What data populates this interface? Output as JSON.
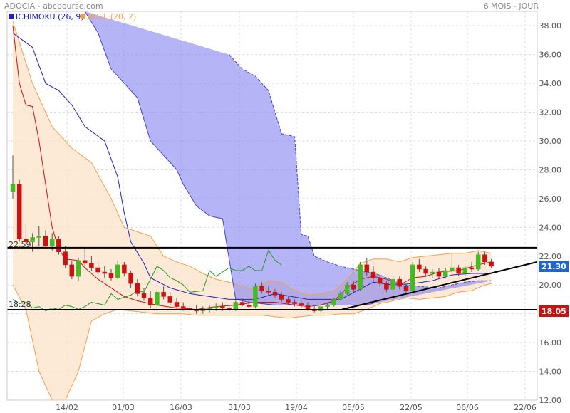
{
  "header": {
    "title": "ADOCIA - abcbourse.com",
    "period": "6 MOIS - JOUR"
  },
  "legend": {
    "ichimoku": "ICHIMOKU (26, 9)",
    "boll": "BOLL (20, 2)"
  },
  "colors": {
    "up": "#44bb22",
    "down": "#cc1111",
    "kijun": "#2222bb",
    "tenkan": "#cc1111",
    "chikou": "#229922",
    "cloud": "#7777ee",
    "boll": "#f3a04a",
    "bollFill": "#fbe3cc",
    "priceTag": "#2266cc",
    "supportTag": "#cc1111"
  },
  "chart_data": {
    "type": "candlestick",
    "ylim": [
      12,
      39
    ],
    "yticks": [
      "12.00",
      "14.00",
      "16.00",
      "18.00",
      "20.00",
      "22.00",
      "24.00",
      "26.00",
      "28.00",
      "30.00",
      "32.00",
      "34.00",
      "36.00",
      "38.00"
    ],
    "xticks": [
      "14/02",
      "01/03",
      "16/03",
      "31/03",
      "19/04",
      "05/05",
      "22/05",
      "06/06",
      "22/06"
    ],
    "levels": {
      "resistance": 22.59,
      "support": 18.28,
      "resistance_label": "22.59",
      "support_label": "18.28"
    },
    "last_price": "21.30",
    "support_tag": "18.05",
    "trendline": {
      "start": [
        "05/05",
        18.3
      ],
      "end": [
        "22/06",
        21.6
      ]
    },
    "candles": [
      [
        26.5,
        29.0,
        26.0,
        27.0
      ],
      [
        27.0,
        27.3,
        23.0,
        23.2
      ],
      [
        23.2,
        24.2,
        22.5,
        23.0
      ],
      [
        23.0,
        23.6,
        22.3,
        23.3
      ],
      [
        23.3,
        24.1,
        22.7,
        23.4
      ],
      [
        23.4,
        23.8,
        22.6,
        22.7
      ],
      [
        22.7,
        23.6,
        22.4,
        23.2
      ],
      [
        23.2,
        23.4,
        22.1,
        22.3
      ],
      [
        22.3,
        22.7,
        21.2,
        21.4
      ],
      [
        21.4,
        21.7,
        20.4,
        20.6
      ],
      [
        20.6,
        21.9,
        20.3,
        21.7
      ],
      [
        21.7,
        22.6,
        21.3,
        21.5
      ],
      [
        21.5,
        22.0,
        21.0,
        21.2
      ],
      [
        21.2,
        21.6,
        20.6,
        20.9
      ],
      [
        20.9,
        21.3,
        20.5,
        20.8
      ],
      [
        20.8,
        21.1,
        20.3,
        20.5
      ],
      [
        20.5,
        21.7,
        20.4,
        21.4
      ],
      [
        21.4,
        21.6,
        20.6,
        20.8
      ],
      [
        20.8,
        21.0,
        19.8,
        20.1
      ],
      [
        20.1,
        20.4,
        19.2,
        19.4
      ],
      [
        19.4,
        19.8,
        18.9,
        19.1
      ],
      [
        19.1,
        19.6,
        18.4,
        18.6
      ],
      [
        18.6,
        19.7,
        18.2,
        19.5
      ],
      [
        19.5,
        19.9,
        19.0,
        19.2
      ],
      [
        19.2,
        19.5,
        18.6,
        18.8
      ],
      [
        18.8,
        19.1,
        18.3,
        18.5
      ],
      [
        18.5,
        18.8,
        18.2,
        18.4
      ],
      [
        18.4,
        18.6,
        18.1,
        18.3
      ],
      [
        18.3,
        18.6,
        18.0,
        18.2
      ],
      [
        18.2,
        18.5,
        18.0,
        18.3
      ],
      [
        18.3,
        18.6,
        18.1,
        18.4
      ],
      [
        18.4,
        18.7,
        18.2,
        18.5
      ],
      [
        18.5,
        18.8,
        18.2,
        18.4
      ],
      [
        18.4,
        18.6,
        18.1,
        18.3
      ],
      [
        18.3,
        18.9,
        18.2,
        18.8
      ],
      [
        18.8,
        19.1,
        18.5,
        18.6
      ],
      [
        18.6,
        18.9,
        18.4,
        18.5
      ],
      [
        18.5,
        20.1,
        18.4,
        19.9
      ],
      [
        19.9,
        20.2,
        19.4,
        19.6
      ],
      [
        19.6,
        19.9,
        19.3,
        19.5
      ],
      [
        19.5,
        19.7,
        19.1,
        19.3
      ],
      [
        19.3,
        19.5,
        18.8,
        19.0
      ],
      [
        19.0,
        19.2,
        18.6,
        18.8
      ],
      [
        18.8,
        19.0,
        18.5,
        18.7
      ],
      [
        18.7,
        18.9,
        18.4,
        18.6
      ],
      [
        18.6,
        18.8,
        18.2,
        18.3
      ],
      [
        18.3,
        18.5,
        18.1,
        18.2
      ],
      [
        18.2,
        18.6,
        18.0,
        18.5
      ],
      [
        18.5,
        18.8,
        18.3,
        18.6
      ],
      [
        18.6,
        19.1,
        18.5,
        19.0
      ],
      [
        19.0,
        19.6,
        18.9,
        19.4
      ],
      [
        19.4,
        20.2,
        19.3,
        20.0
      ],
      [
        20.0,
        20.3,
        19.5,
        19.7
      ],
      [
        19.7,
        21.6,
        19.6,
        21.4
      ],
      [
        21.4,
        21.9,
        20.6,
        20.9
      ],
      [
        20.9,
        21.3,
        20.3,
        20.5
      ],
      [
        20.5,
        20.7,
        19.9,
        20.1
      ],
      [
        20.1,
        20.3,
        19.5,
        19.7
      ],
      [
        19.7,
        20.6,
        19.6,
        20.4
      ],
      [
        20.4,
        20.6,
        19.7,
        19.9
      ],
      [
        19.9,
        20.1,
        19.4,
        19.6
      ],
      [
        19.6,
        21.6,
        19.5,
        21.4
      ],
      [
        21.4,
        21.8,
        20.9,
        21.1
      ],
      [
        21.1,
        21.3,
        20.6,
        20.8
      ],
      [
        20.8,
        21.1,
        20.5,
        20.9
      ],
      [
        20.9,
        21.2,
        20.4,
        20.6
      ],
      [
        20.6,
        21.2,
        20.5,
        21.0
      ],
      [
        21.0,
        22.3,
        20.8,
        21.2
      ],
      [
        21.2,
        21.4,
        20.6,
        20.8
      ],
      [
        20.8,
        21.3,
        20.6,
        21.2
      ],
      [
        21.2,
        21.6,
        20.9,
        21.1
      ],
      [
        21.1,
        22.3,
        21.0,
        22.1
      ],
      [
        22.1,
        22.3,
        21.4,
        21.6
      ],
      [
        21.6,
        21.8,
        21.2,
        21.3
      ]
    ],
    "bollinger": {
      "upper": [
        [
          0,
          38.3
        ],
        [
          3,
          34.0
        ],
        [
          6,
          31.0
        ],
        [
          9,
          29.5
        ],
        [
          12,
          28.5
        ],
        [
          15,
          26.0
        ],
        [
          17,
          24.0
        ],
        [
          19,
          23.7
        ],
        [
          21,
          23.4
        ],
        [
          23,
          22.0
        ],
        [
          25,
          21.6
        ],
        [
          27,
          21.3
        ],
        [
          29,
          20.8
        ],
        [
          31,
          20.4
        ],
        [
          33,
          20.2
        ],
        [
          35,
          19.9
        ],
        [
          37,
          19.7
        ],
        [
          39,
          20.3
        ],
        [
          41,
          20.2
        ],
        [
          43,
          19.6
        ],
        [
          45,
          19.3
        ],
        [
          47,
          19.4
        ],
        [
          49,
          19.6
        ],
        [
          51,
          20.4
        ],
        [
          53,
          21.5
        ],
        [
          55,
          21.8
        ],
        [
          57,
          21.8
        ],
        [
          59,
          21.6
        ],
        [
          61,
          21.9
        ],
        [
          63,
          22.0
        ],
        [
          65,
          22.1
        ],
        [
          67,
          22.2
        ],
        [
          69,
          22.2
        ],
        [
          71,
          22.4
        ],
        [
          73,
          22.2
        ]
      ],
      "lower": [
        [
          0,
          20.0
        ],
        [
          2,
          18.3
        ],
        [
          4,
          14.0
        ],
        [
          6,
          12.0
        ],
        [
          8,
          12.0
        ],
        [
          10,
          14.0
        ],
        [
          12,
          17.5
        ],
        [
          14,
          18.0
        ],
        [
          16,
          18.3
        ],
        [
          18,
          18.2
        ],
        [
          20,
          18.1
        ],
        [
          22,
          18.0
        ],
        [
          24,
          18.0
        ],
        [
          26,
          18.0
        ],
        [
          28,
          17.9
        ],
        [
          30,
          17.9
        ],
        [
          32,
          17.9
        ],
        [
          34,
          17.9
        ],
        [
          36,
          17.9
        ],
        [
          38,
          17.9
        ],
        [
          40,
          17.8
        ],
        [
          42,
          17.7
        ],
        [
          44,
          17.8
        ],
        [
          46,
          17.9
        ],
        [
          48,
          17.9
        ],
        [
          50,
          18.0
        ],
        [
          52,
          18.0
        ],
        [
          54,
          18.3
        ],
        [
          56,
          18.7
        ],
        [
          58,
          18.9
        ],
        [
          60,
          19.1
        ],
        [
          62,
          19.0
        ],
        [
          64,
          19.1
        ],
        [
          66,
          19.2
        ],
        [
          68,
          19.5
        ],
        [
          70,
          19.6
        ],
        [
          72,
          20.0
        ],
        [
          73,
          20.1
        ]
      ]
    },
    "ichimoku": {
      "kijun": [
        [
          0,
          37.5
        ],
        [
          3,
          36.5
        ],
        [
          5,
          34.0
        ],
        [
          7,
          33.5
        ],
        [
          9,
          32.5
        ],
        [
          11,
          31.0
        ],
        [
          14,
          30.0
        ],
        [
          16,
          27.5
        ],
        [
          17,
          25.0
        ],
        [
          18,
          23.0
        ],
        [
          20,
          21.5
        ],
        [
          21,
          20.5
        ],
        [
          24,
          19.8
        ],
        [
          27,
          19.4
        ],
        [
          30,
          19.2
        ],
        [
          33,
          19.0
        ],
        [
          37,
          19.0
        ],
        [
          40,
          19.4
        ],
        [
          45,
          19.0
        ],
        [
          50,
          19.0
        ],
        [
          55,
          20.2
        ],
        [
          58,
          20.0
        ],
        [
          61,
          20.1
        ],
        [
          64,
          20.3
        ],
        [
          67,
          20.7
        ],
        [
          70,
          20.8
        ],
        [
          73,
          20.8
        ]
      ],
      "tenkan": [
        [
          0,
          38.0
        ],
        [
          1,
          34.0
        ],
        [
          2,
          32.5
        ],
        [
          3,
          32.4
        ],
        [
          4,
          30.0
        ],
        [
          5,
          27.0
        ],
        [
          6,
          24.0
        ],
        [
          7,
          22.5
        ],
        [
          8,
          21.8
        ],
        [
          10,
          21.7
        ],
        [
          11,
          21.2
        ],
        [
          13,
          20.4
        ],
        [
          15,
          19.8
        ],
        [
          17,
          19.2
        ],
        [
          19,
          18.9
        ],
        [
          22,
          18.6
        ],
        [
          25,
          18.4
        ],
        [
          28,
          18.3
        ],
        [
          31,
          18.5
        ],
        [
          34,
          18.6
        ],
        [
          37,
          18.8
        ],
        [
          40,
          18.8
        ],
        [
          43,
          18.6
        ],
        [
          45,
          18.5
        ],
        [
          47,
          18.6
        ],
        [
          49,
          18.9
        ],
        [
          51,
          19.8
        ],
        [
          53,
          20.4
        ],
        [
          55,
          20.6
        ],
        [
          57,
          20.4
        ],
        [
          59,
          20.0
        ],
        [
          61,
          20.5
        ],
        [
          63,
          20.6
        ],
        [
          65,
          20.9
        ],
        [
          68,
          21.0
        ],
        [
          71,
          21.4
        ],
        [
          73,
          21.6
        ]
      ],
      "chikou": [
        [
          0,
          19.0
        ],
        [
          1,
          18.7
        ],
        [
          2,
          18.8
        ],
        [
          3,
          18.4
        ],
        [
          4,
          18.5
        ],
        [
          5,
          18.2
        ],
        [
          6,
          18.4
        ],
        [
          7,
          18.3
        ],
        [
          8,
          18.6
        ],
        [
          9,
          18.5
        ],
        [
          10,
          18.3
        ],
        [
          11,
          18.5
        ],
        [
          12,
          18.8
        ],
        [
          14,
          18.6
        ],
        [
          15,
          19.4
        ],
        [
          16,
          19.0
        ],
        [
          18,
          19.3
        ],
        [
          19,
          19.6
        ],
        [
          20,
          19.5
        ],
        [
          21,
          20.4
        ],
        [
          22,
          21.3
        ],
        [
          23,
          21.0
        ],
        [
          24,
          20.5
        ],
        [
          25,
          20.3
        ],
        [
          26,
          20.0
        ],
        [
          27,
          19.5
        ],
        [
          29,
          19.6
        ],
        [
          30,
          21.0
        ],
        [
          31,
          20.6
        ],
        [
          33,
          21.2
        ],
        [
          34,
          21.0
        ],
        [
          35,
          21.0
        ],
        [
          36,
          21.3
        ],
        [
          37,
          21.0
        ],
        [
          38,
          21.0
        ],
        [
          39,
          22.4
        ],
        [
          40,
          21.7
        ],
        [
          41,
          21.4
        ]
      ],
      "spanA": [
        [
          33,
          36.0
        ],
        [
          35,
          35.0
        ],
        [
          37,
          34.5
        ],
        [
          39,
          33.5
        ],
        [
          40,
          32.0
        ],
        [
          41,
          30.5
        ],
        [
          42,
          30.4
        ],
        [
          43,
          30.3
        ],
        [
          44,
          23.5
        ],
        [
          45,
          23.4
        ],
        [
          46,
          22.0
        ],
        [
          48,
          21.6
        ],
        [
          50,
          21.3
        ],
        [
          52,
          21.1
        ],
        [
          54,
          20.9
        ],
        [
          56,
          20.7
        ],
        [
          58,
          20.3
        ],
        [
          60,
          20.0
        ],
        [
          62,
          19.9
        ],
        [
          65,
          19.8
        ],
        [
          67,
          20.0
        ],
        [
          69,
          20.2
        ],
        [
          71,
          20.3
        ],
        [
          73,
          20.3
        ]
      ],
      "cloudTop": [
        [
          11,
          39.0
        ],
        [
          13,
          37.5
        ],
        [
          15,
          35.0
        ],
        [
          17,
          34.0
        ],
        [
          19,
          33.0
        ],
        [
          21,
          30.0
        ],
        [
          23,
          29.0
        ],
        [
          25,
          28.0
        ],
        [
          26,
          27.0
        ],
        [
          28,
          25.5
        ],
        [
          30,
          24.8
        ],
        [
          32,
          24.6
        ],
        [
          34,
          19.0
        ],
        [
          36,
          18.8
        ],
        [
          40,
          18.6
        ],
        [
          45,
          18.6
        ],
        [
          50,
          18.6
        ],
        [
          53,
          18.6
        ],
        [
          55,
          18.7
        ]
      ],
      "cloudBot": [
        [
          11,
          39.0
        ],
        [
          55,
          18.7
        ]
      ]
    }
  }
}
